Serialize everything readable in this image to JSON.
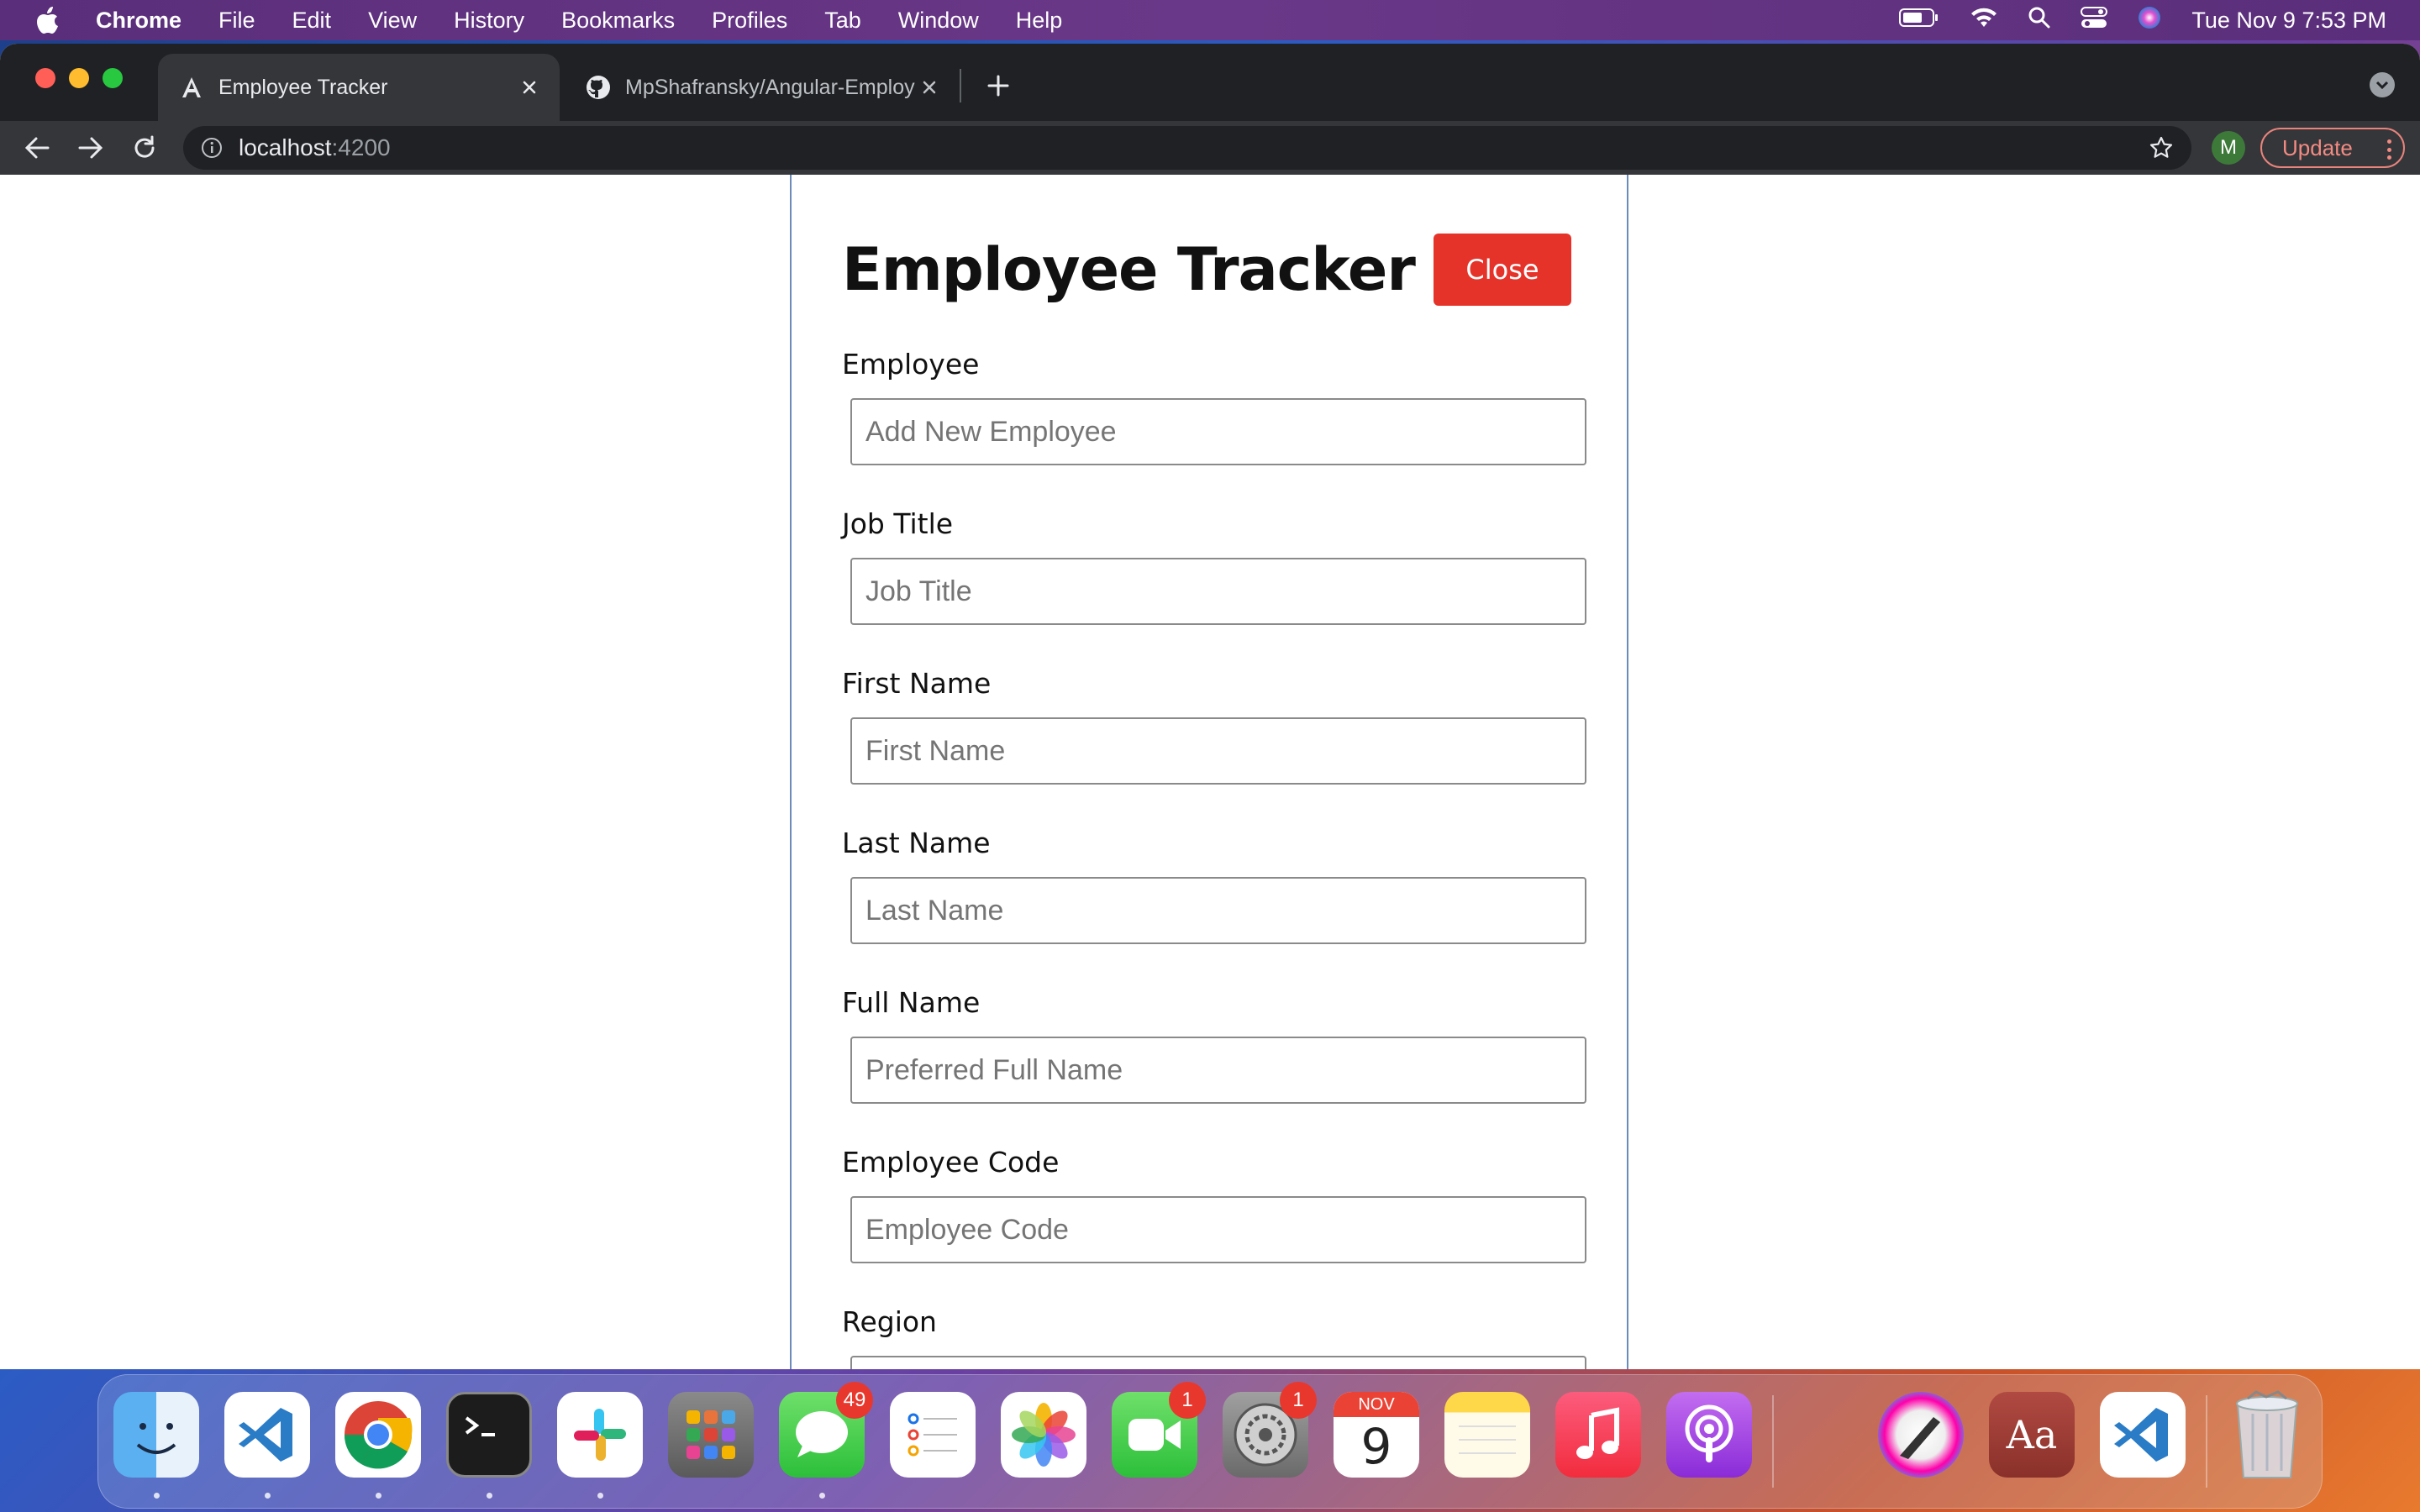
{
  "menubar": {
    "app_name": "Chrome",
    "items": [
      "File",
      "Edit",
      "View",
      "History",
      "Bookmarks",
      "Profiles",
      "Tab",
      "Window",
      "Help"
    ],
    "clock": "Tue Nov 9  7:53 PM"
  },
  "browser": {
    "tabs": [
      {
        "title": "Employee Tracker",
        "favicon": "angular-icon",
        "active": true
      },
      {
        "title": "MpShafransky/Angular-Employ",
        "favicon": "github-icon",
        "active": false
      }
    ],
    "url_host": "localhost",
    "url_port": ":4200",
    "profile_initial": "M",
    "update_label": "Update"
  },
  "form": {
    "title": "Employee Tracker",
    "close_label": "Close",
    "fields": [
      {
        "label": "Employee",
        "placeholder": "Add New Employee"
      },
      {
        "label": "Job Title",
        "placeholder": "Job Title"
      },
      {
        "label": "First Name",
        "placeholder": "First Name"
      },
      {
        "label": "Last Name",
        "placeholder": "Last Name"
      },
      {
        "label": "Full Name",
        "placeholder": "Preferred Full Name"
      },
      {
        "label": "Employee Code",
        "placeholder": "Employee Code"
      },
      {
        "label": "Region",
        "placeholder": ""
      }
    ]
  },
  "dock": {
    "apps": [
      "finder-icon",
      "vscode-icon",
      "chrome-icon",
      "terminal-icon",
      "slack-icon",
      "launchpad-icon",
      "messages-icon",
      "reminders-icon",
      "photos-icon",
      "facetime-icon",
      "system-preferences-icon",
      "calendar-icon",
      "notes-icon",
      "music-icon",
      "podcasts-icon",
      "sketchbook-icon",
      "dictionary-icon",
      "vscode-icon",
      "trash-icon"
    ],
    "messages_badge": "49",
    "facetime_badge": "1",
    "settings_badge": "1",
    "calendar_month": "NOV",
    "calendar_day": "9",
    "dictionary_label": "Aa"
  },
  "colors": {
    "close_button": "#e6332a",
    "card_border": "#6b8cb8",
    "chrome_dark": "#202124"
  }
}
